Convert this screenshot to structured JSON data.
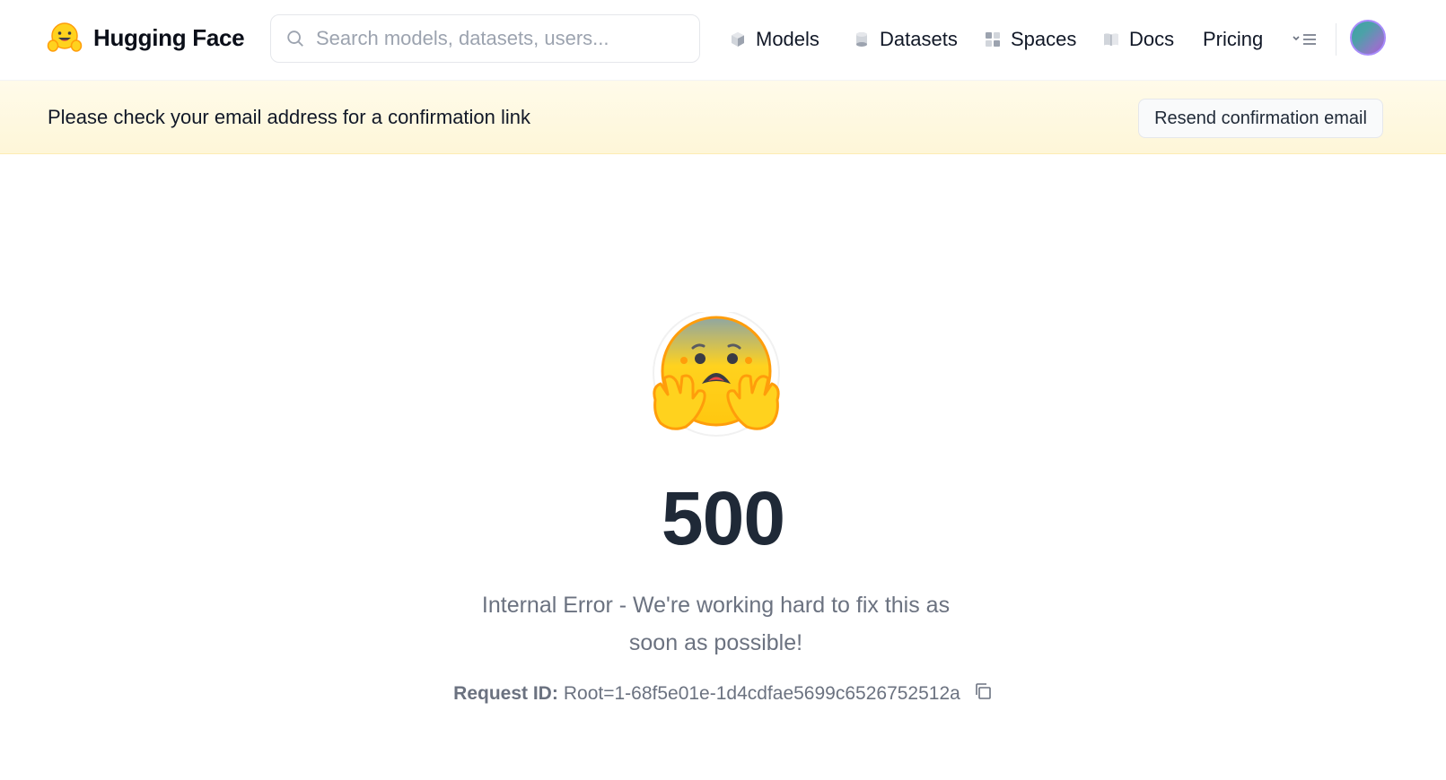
{
  "header": {
    "brand": "Hugging Face",
    "search_placeholder": "Search models, datasets, users...",
    "nav": [
      {
        "label": "Models",
        "icon": "cube-icon"
      },
      {
        "label": "Datasets",
        "icon": "database-icon"
      },
      {
        "label": "Spaces",
        "icon": "grid-icon"
      },
      {
        "label": "Docs",
        "icon": "book-icon"
      },
      {
        "label": "Pricing"
      }
    ]
  },
  "banner": {
    "text": "Please check your email address for a confirmation link",
    "button": "Resend confirmation email"
  },
  "error": {
    "code": "500",
    "message": "Internal Error - We're working hard to fix this as soon as possible!",
    "request_id_label": "Request ID:",
    "request_id": "Root=1-68f5e01e-1d4cdfae5699c6526752512a"
  },
  "colors": {
    "banner_bg": "#fef9e1",
    "code_text": "#1f2937",
    "muted_text": "#6b7280"
  }
}
